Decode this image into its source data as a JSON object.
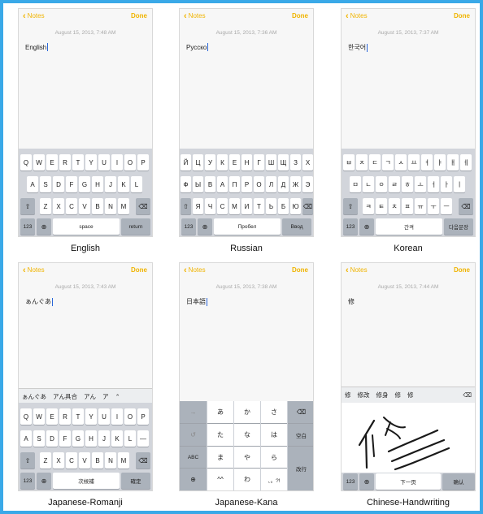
{
  "common": {
    "back_label": "Notes",
    "done_label": "Done"
  },
  "english": {
    "date": "August 15, 2013, 7:48 AM",
    "note": "English",
    "caption": "English",
    "rows": [
      [
        "Q",
        "W",
        "E",
        "R",
        "T",
        "Y",
        "U",
        "I",
        "O",
        "P"
      ],
      [
        "A",
        "S",
        "D",
        "F",
        "G",
        "H",
        "J",
        "K",
        "L"
      ],
      [
        "Z",
        "X",
        "C",
        "V",
        "B",
        "N",
        "M"
      ]
    ],
    "num": "123",
    "space": "space",
    "return": "return"
  },
  "russian": {
    "date": "August 15, 2013, 7:36 AM",
    "note": "Русско",
    "caption": "Russian",
    "rows": [
      [
        "Й",
        "Ц",
        "У",
        "К",
        "Е",
        "Н",
        "Г",
        "Ш",
        "Щ",
        "З",
        "Х"
      ],
      [
        "Ф",
        "Ы",
        "В",
        "А",
        "П",
        "Р",
        "О",
        "Л",
        "Д",
        "Ж",
        "Э"
      ],
      [
        "Я",
        "Ч",
        "С",
        "М",
        "И",
        "Т",
        "Ь",
        "Б",
        "Ю"
      ]
    ],
    "num": "123",
    "space": "Пробел",
    "return": "Ввод"
  },
  "korean": {
    "date": "August 15, 2013, 7:37 AM",
    "note": "한국어",
    "caption": "Korean",
    "rows": [
      [
        "ㅂ",
        "ㅈ",
        "ㄷ",
        "ㄱ",
        "ㅅ",
        "ㅛ",
        "ㅕ",
        "ㅑ",
        "ㅐ",
        "ㅔ"
      ],
      [
        "ㅁ",
        "ㄴ",
        "ㅇ",
        "ㄹ",
        "ㅎ",
        "ㅗ",
        "ㅓ",
        "ㅏ",
        "ㅣ"
      ],
      [
        "ㅋ",
        "ㅌ",
        "ㅊ",
        "ㅍ",
        "ㅠ",
        "ㅜ",
        "ㅡ"
      ]
    ],
    "num": "123",
    "space": "간격",
    "return": "다음문장"
  },
  "japanese_romanji": {
    "date": "August 15, 2013, 7:43 AM",
    "note": "ぁんぐあ",
    "caption": "Japanese-Romanji",
    "suggestions": [
      "ぁんぐあ",
      "アん具合",
      "アん",
      "ア"
    ],
    "rows": [
      [
        "Q",
        "W",
        "E",
        "R",
        "T",
        "Y",
        "U",
        "I",
        "O",
        "P"
      ],
      [
        "A",
        "S",
        "D",
        "F",
        "G",
        "H",
        "J",
        "K",
        "L",
        "—"
      ],
      [
        "Z",
        "X",
        "C",
        "V",
        "B",
        "N",
        "M"
      ]
    ],
    "num": "123",
    "space": "次候補",
    "return": "確定"
  },
  "japanese_kana": {
    "date": "August 15, 2013, 7:38 AM",
    "note": "日本語",
    "caption": "Japanese-Kana",
    "kana_rows": [
      [
        "あ",
        "か",
        "さ"
      ],
      [
        "た",
        "な",
        "は"
      ],
      [
        "ま",
        "や",
        "ら"
      ],
      [
        "^^",
        "わ",
        "、。?!"
      ]
    ],
    "left_keys": [
      "→",
      "↺",
      "ABC",
      ""
    ],
    "right_keys": [
      "⌫",
      "空白",
      "改行"
    ]
  },
  "chinese_handwriting": {
    "date": "August 15, 2013, 7:44 AM",
    "note": "修",
    "caption": "Chinese-Handwriting",
    "suggestions": [
      "修",
      "修改",
      "修身",
      "修",
      "修"
    ],
    "num": "123",
    "next": "下一页",
    "confirm": "确认"
  }
}
